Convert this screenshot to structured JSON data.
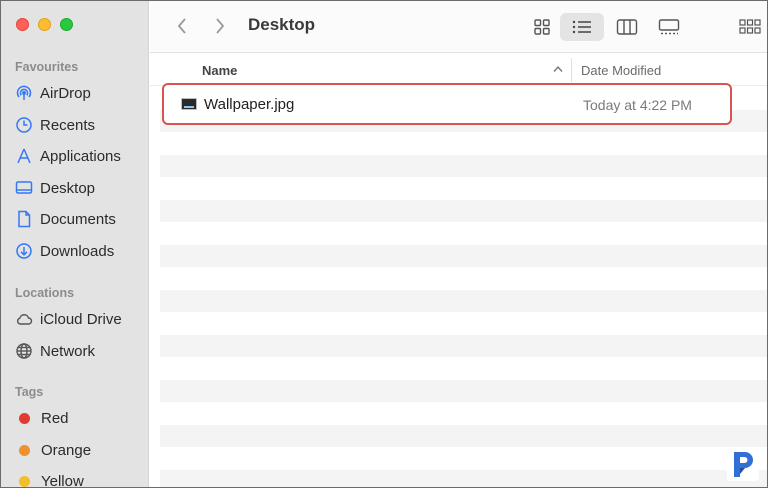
{
  "window": {
    "title": "Desktop"
  },
  "sidebar": {
    "favourites_title": "Favourites",
    "favourites": [
      {
        "label": "AirDrop",
        "icon": "airdrop-icon"
      },
      {
        "label": "Recents",
        "icon": "clock-icon"
      },
      {
        "label": "Applications",
        "icon": "applications-icon"
      },
      {
        "label": "Desktop",
        "icon": "desktop-icon"
      },
      {
        "label": "Documents",
        "icon": "document-icon"
      },
      {
        "label": "Downloads",
        "icon": "download-icon"
      }
    ],
    "locations_title": "Locations",
    "locations": [
      {
        "label": "iCloud Drive",
        "icon": "cloud-icon"
      },
      {
        "label": "Network",
        "icon": "globe-icon"
      }
    ],
    "tags_title": "Tags",
    "tags": [
      {
        "label": "Red",
        "color": "#e33a30"
      },
      {
        "label": "Orange",
        "color": "#f0902c"
      },
      {
        "label": "Yellow",
        "color": "#efc02c"
      }
    ]
  },
  "columns": {
    "name": "Name",
    "date": "Date Modified"
  },
  "files": [
    {
      "name": "Wallpaper.jpg",
      "date": "Today at 4:22 PM",
      "icon": "image-file-icon"
    }
  ],
  "colors": {
    "accent": "#3478f6",
    "highlight_border": "#d9534f",
    "sidebar_bg": "#e4e3e3"
  }
}
